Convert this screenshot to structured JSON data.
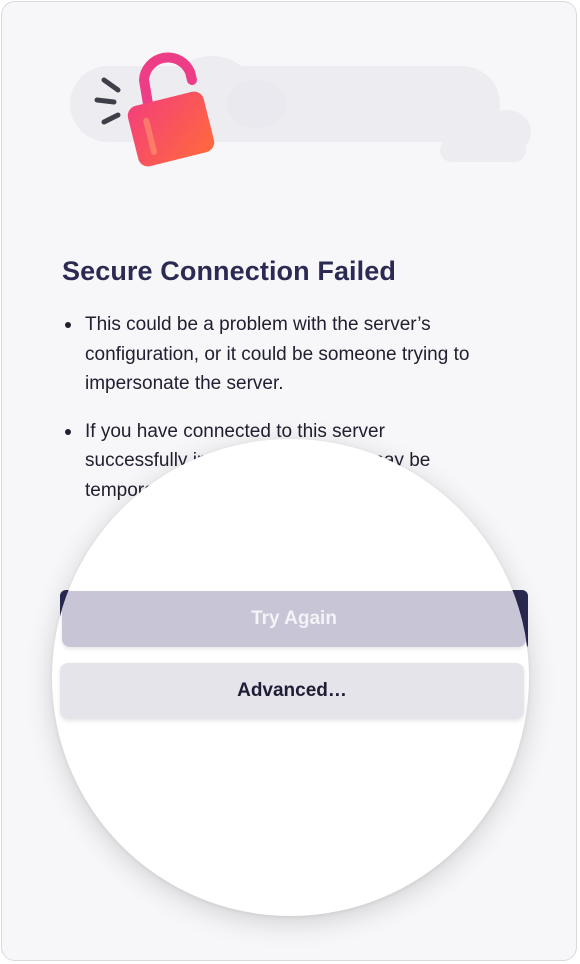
{
  "error": {
    "title": "Secure Connection Failed",
    "bullets": [
      {
        "text": "This could be a problem with the server’s configuration, or it could be someone trying to impersonate the server."
      },
      {
        "text": "If you have connected to this server successfully in the past, the error may be temporary, and you can try again later."
      }
    ]
  },
  "buttons": {
    "try_again": "Try Again",
    "advanced": "Advanced…"
  },
  "icons": {
    "illustration": "broken-padlock-icon"
  },
  "colors": {
    "title": "#2b2a53",
    "primary_button": "#2b2a53",
    "padlock_gradient_start": "#f43f7a",
    "padlock_gradient_end": "#ff6a3d",
    "cloud": "#ececf1"
  }
}
